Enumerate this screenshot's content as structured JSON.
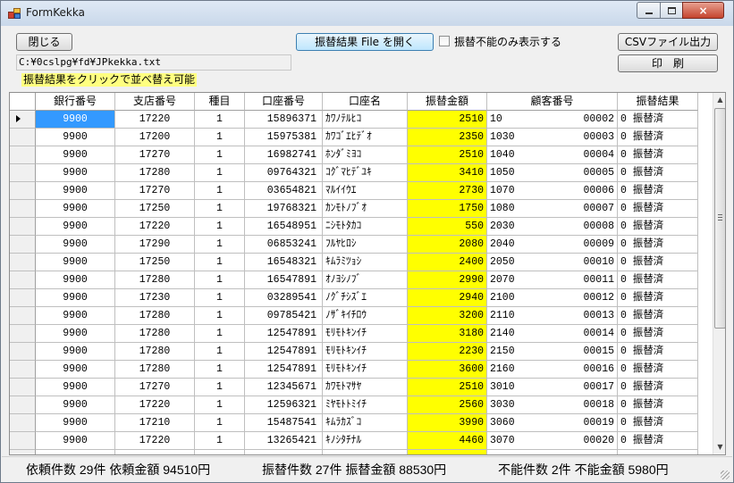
{
  "window": {
    "title": "FormKekka",
    "minimize_glyph": "minimize-icon",
    "maximize_glyph": "maximize-icon",
    "close_glyph": "×"
  },
  "toolbar": {
    "close_label": "閉じる",
    "open_file_label": "振替結果 File を開く",
    "unable_only_label": "振替不能のみ表示する",
    "unable_only_checked": false,
    "csv_export_label": "CSVファイル出力",
    "print_label": "印　刷"
  },
  "file_path": "C:¥0cslpg¥fd¥JPkekka.txt",
  "sort_hint": "振替結果をクリックで並べ替え可能",
  "colors": {
    "amount_column": "#ffff00",
    "selection": "#3399ff",
    "hint_background": "#ffff80"
  },
  "grid": {
    "columns": [
      "銀行番号",
      "支店番号",
      "種目",
      "口座番号",
      "口座名",
      "振替金額",
      "顧客番号",
      "振替結果"
    ],
    "rows": [
      {
        "bank": "9900",
        "branch": "17220",
        "type": "1",
        "account": "15896371",
        "name": "ｶﾜﾉﾃﾙﾋｺ",
        "amount": "2510",
        "cust_a": "10",
        "cust_b": "00002",
        "result": "0 振替済"
      },
      {
        "bank": "9900",
        "branch": "17200",
        "type": "1",
        "account": "15975381",
        "name": "ｶﾜｺﾞｴﾋﾃﾞｵ",
        "amount": "2350",
        "cust_a": "1030",
        "cust_b": "00003",
        "result": "0 振替済"
      },
      {
        "bank": "9900",
        "branch": "17270",
        "type": "1",
        "account": "16982741",
        "name": "ﾎﾝﾀﾞﾐﾖｺ",
        "amount": "2510",
        "cust_a": "1040",
        "cust_b": "00004",
        "result": "0 振替済"
      },
      {
        "bank": "9900",
        "branch": "17280",
        "type": "1",
        "account": "09764321",
        "name": "ｺｸﾞﾏﾋﾃﾞﾕｷ",
        "amount": "3410",
        "cust_a": "1050",
        "cust_b": "00005",
        "result": "0 振替済"
      },
      {
        "bank": "9900",
        "branch": "17270",
        "type": "1",
        "account": "03654821",
        "name": "ﾏﾙｲｲｳｴ",
        "amount": "2730",
        "cust_a": "1070",
        "cust_b": "00006",
        "result": "0 振替済"
      },
      {
        "bank": "9900",
        "branch": "17250",
        "type": "1",
        "account": "19768321",
        "name": "ｶﾝﾓﾄﾉﾌﾞｵ",
        "amount": "1750",
        "cust_a": "1080",
        "cust_b": "00007",
        "result": "0 振替済"
      },
      {
        "bank": "9900",
        "branch": "17220",
        "type": "1",
        "account": "16548951",
        "name": "ﾆｼﾓﾄﾀｶｺ",
        "amount": "550",
        "cust_a": "2030",
        "cust_b": "00008",
        "result": "0 振替済"
      },
      {
        "bank": "9900",
        "branch": "17290",
        "type": "1",
        "account": "06853241",
        "name": "ﾌﾙﾔﾋﾛｼ",
        "amount": "2080",
        "cust_a": "2040",
        "cust_b": "00009",
        "result": "0 振替済"
      },
      {
        "bank": "9900",
        "branch": "17250",
        "type": "1",
        "account": "16548321",
        "name": "ｷﾑﾗﾐﾂｮｼ",
        "amount": "2400",
        "cust_a": "2050",
        "cust_b": "00010",
        "result": "0 振替済"
      },
      {
        "bank": "9900",
        "branch": "17280",
        "type": "1",
        "account": "16547891",
        "name": "ｵﾉﾖｼﾉﾌﾞ",
        "amount": "2990",
        "cust_a": "2070",
        "cust_b": "00011",
        "result": "0 振替済"
      },
      {
        "bank": "9900",
        "branch": "17230",
        "type": "1",
        "account": "03289541",
        "name": "ﾉｸﾞﾁｼｽﾞｴ",
        "amount": "2940",
        "cust_a": "2100",
        "cust_b": "00012",
        "result": "0 振替済"
      },
      {
        "bank": "9900",
        "branch": "17280",
        "type": "1",
        "account": "09785421",
        "name": "ﾉｻﾞｷｲﾁﾛｳ",
        "amount": "3200",
        "cust_a": "2110",
        "cust_b": "00013",
        "result": "0 振替済"
      },
      {
        "bank": "9900",
        "branch": "17280",
        "type": "1",
        "account": "12547891",
        "name": "ﾓﾘﾓﾄｷﾝｲﾁ",
        "amount": "3180",
        "cust_a": "2140",
        "cust_b": "00014",
        "result": "0 振替済"
      },
      {
        "bank": "9900",
        "branch": "17280",
        "type": "1",
        "account": "12547891",
        "name": "ﾓﾘﾓﾄｷﾝｲﾁ",
        "amount": "2230",
        "cust_a": "2150",
        "cust_b": "00015",
        "result": "0 振替済"
      },
      {
        "bank": "9900",
        "branch": "17280",
        "type": "1",
        "account": "12547891",
        "name": "ﾓﾘﾓﾄｷﾝｲﾁ",
        "amount": "3600",
        "cust_a": "2160",
        "cust_b": "00016",
        "result": "0 振替済"
      },
      {
        "bank": "9900",
        "branch": "17270",
        "type": "1",
        "account": "12345671",
        "name": "ｶﾜﾓﾄﾏｻﾔ",
        "amount": "2510",
        "cust_a": "3010",
        "cust_b": "00017",
        "result": "0 振替済"
      },
      {
        "bank": "9900",
        "branch": "17220",
        "type": "1",
        "account": "12596321",
        "name": "ﾐﾔﾓﾄﾄﾐｲﾁ",
        "amount": "2560",
        "cust_a": "3030",
        "cust_b": "00018",
        "result": "0 振替済"
      },
      {
        "bank": "9900",
        "branch": "17210",
        "type": "1",
        "account": "15487541",
        "name": "ｷﾑﾗｶｽﾞｺ",
        "amount": "3990",
        "cust_a": "3060",
        "cust_b": "00019",
        "result": "0 振替済"
      },
      {
        "bank": "9900",
        "branch": "17220",
        "type": "1",
        "account": "13265421",
        "name": "ｷﾉｼﾀﾁﾅﾙ",
        "amount": "4460",
        "cust_a": "3070",
        "cust_b": "00020",
        "result": "0 振替済"
      },
      {
        "bank": "",
        "branch": "",
        "type": "",
        "account": "",
        "name": "",
        "amount": "",
        "cust_a": "",
        "cust_b": "",
        "result": ""
      }
    ]
  },
  "status": {
    "request": "依頼件数 29件  依頼金額 94510円",
    "transferred": "振替件数 27件  振替金額 88530円",
    "unable": "不能件数 2件  不能金額 5980円"
  }
}
